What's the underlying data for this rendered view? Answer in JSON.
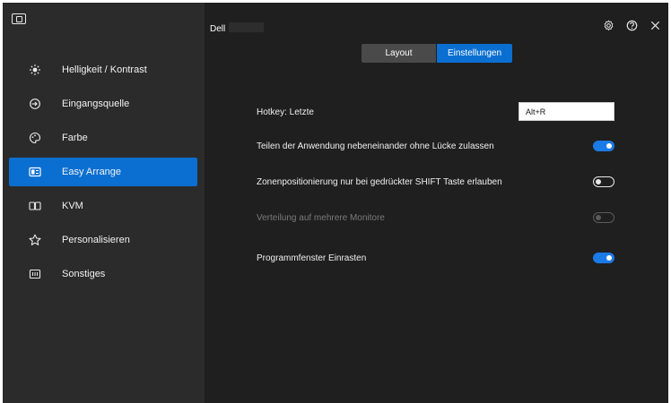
{
  "sidebar": {
    "items": [
      {
        "label": "Helligkeit / Kontrast",
        "icon": "brightness-icon",
        "active": false
      },
      {
        "label": "Eingangsquelle",
        "icon": "input-source-icon",
        "active": false
      },
      {
        "label": "Farbe",
        "icon": "color-palette-icon",
        "active": false
      },
      {
        "label": "Easy Arrange",
        "icon": "easy-arrange-icon",
        "active": true
      },
      {
        "label": "KVM",
        "icon": "kvm-icon",
        "active": false
      },
      {
        "label": "Personalisieren",
        "icon": "star-icon",
        "active": false
      },
      {
        "label": "Sonstiges",
        "icon": "others-icon",
        "active": false
      }
    ]
  },
  "header": {
    "monitor_label": "Dell"
  },
  "tabs": [
    {
      "label": "Layout",
      "active": false
    },
    {
      "label": "Einstellungen",
      "active": true
    }
  ],
  "settings": {
    "hotkey_label": "Hotkey: Letzte",
    "hotkey_value": "Alt+R",
    "rows": [
      {
        "label": "Teilen der Anwendung nebeneinander ohne Lücke zulassen",
        "state": "on",
        "disabled": false
      },
      {
        "label": "Zonenpositionierung nur bei gedrückter SHIFT Taste erlauben",
        "state": "off",
        "disabled": false
      },
      {
        "label": "Verteilung auf mehrere Monitore",
        "state": "off",
        "disabled": true
      },
      {
        "label": "Programmfenster Einrasten",
        "state": "on",
        "disabled": false
      }
    ]
  },
  "colors": {
    "accent": "#0b6fd1",
    "sidebar_bg": "#2b2b2b",
    "main_bg": "#1f1f1f"
  }
}
